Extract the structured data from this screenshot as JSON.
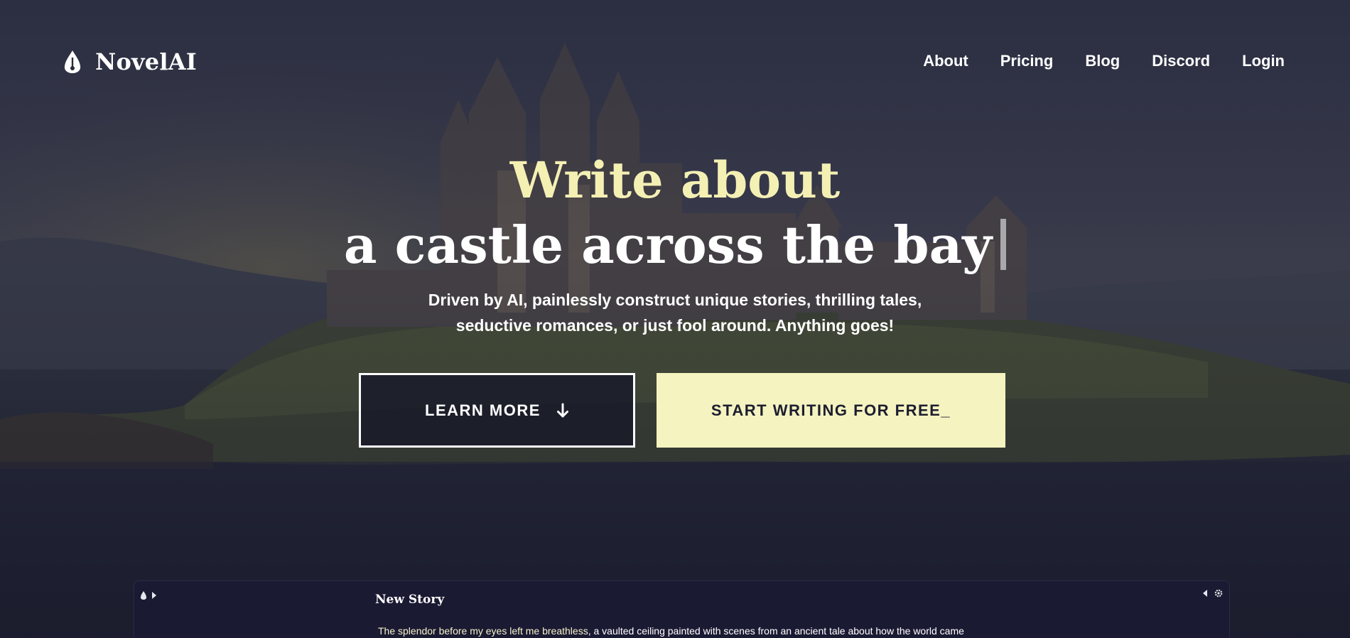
{
  "header": {
    "logo_text": "NovelAI",
    "logo_icon": "novelai-pen-nib-icon",
    "nav": [
      {
        "label": "About"
      },
      {
        "label": "Pricing"
      },
      {
        "label": "Blog"
      },
      {
        "label": "Discord"
      },
      {
        "label": "Login"
      }
    ]
  },
  "hero": {
    "title_line1": "Write about",
    "title_line2": "a castle across the bay",
    "subtitle_line1": "Driven by AI, painlessly construct unique stories, thrilling tales,",
    "subtitle_line2": "seductive romances, or just fool around. Anything goes!",
    "learn_more_label": "LEARN MORE",
    "learn_more_icon": "arrow-down-icon",
    "start_label": "START WRITING FOR FREE_"
  },
  "editor_preview": {
    "title": "New Story",
    "text_highlight": "The splendor before my eyes left me breathless",
    "text_rest": ", a vaulted ceiling painted with scenes from an ancient tale about how the world came",
    "icons": [
      "novelai-icon",
      "chevron-right-icon",
      "chevron-left-icon",
      "gear-icon"
    ]
  },
  "colors": {
    "accent": "#f5f3c0",
    "title_accent": "#f4f0b4",
    "background": "#1e2030",
    "editor_bg": "#1b1a33"
  }
}
